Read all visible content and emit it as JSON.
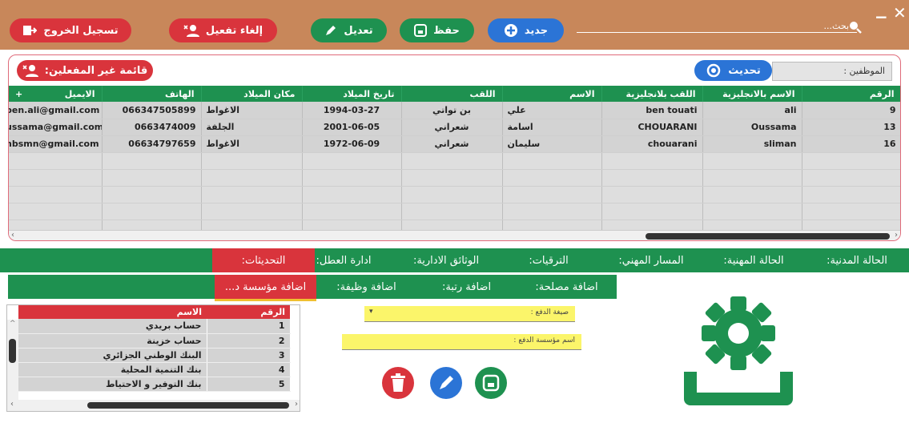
{
  "toolbar": {
    "logout": "تسجيل الخروج",
    "deactivate": "إلغاء تفعيل",
    "edit": "تعديل",
    "save": "حفظ",
    "new": "جديد",
    "search_placeholder": "بحث..."
  },
  "employees": {
    "label": "الموظفين :",
    "refresh": "تحديث",
    "inactive_list": "قائمة غير المفعلين:",
    "columns": [
      "الرقم",
      "الاسم بالانجليزية",
      "اللقب بلانجليزية",
      "الاسم",
      "اللقب",
      "تاريخ الميلاد",
      "مكان الميلاد",
      "الهاتف",
      "الايميل"
    ],
    "rows": [
      {
        "id": "9",
        "first_en": "ali",
        "last_en": "ben touati",
        "first": "علي",
        "last": "بن تواتي",
        "dob": "1994-03-27",
        "pob": "الاغواط",
        "phone": "066347505899",
        "email": "ben.ali@gmail.com"
      },
      {
        "id": "13",
        "first_en": "Oussama",
        "last_en": "CHOUARANI",
        "first": "اسامة",
        "last": "شعراني",
        "dob": "2001-06-05",
        "pob": "الجلفة",
        "phone": "0663474009",
        "email": "ussama@gmail.com"
      },
      {
        "id": "16",
        "first_en": "sliman",
        "last_en": "chouarani",
        "first": "سليمان",
        "last": "شعراني",
        "dob": "1972-06-09",
        "pob": "الاغواط",
        "phone": "06634797659",
        "email": "nbsmn@gmail.com"
      }
    ]
  },
  "tabs_main": [
    "الحالة المدنية:",
    "الحالة المهنية:",
    "المسار المهني:",
    "الترقيات:",
    "الوثائق الادارية:",
    "ادارة العطل:",
    "التحديثات:"
  ],
  "tabs_sub": [
    "اضافة مصلحة:",
    "اضافة رتبة:",
    "اضافة وظيفة:",
    "اضافة مؤسسة د..."
  ],
  "banks": {
    "col_num": "الرقم",
    "col_name": "الاسم",
    "rows": [
      {
        "n": "1",
        "name": "حساب بريدي"
      },
      {
        "n": "2",
        "name": "حساب خزينة"
      },
      {
        "n": "3",
        "name": "البنك الوطني الجزائري"
      },
      {
        "n": "4",
        "name": "بنك التنمية المحلية"
      },
      {
        "n": "5",
        "name": "بنك التوفير و الاحتياط"
      }
    ]
  },
  "form": {
    "payment_method": "صيغة الدفع :",
    "payment_institution": "اسم مؤسسة الدفع :"
  },
  "colors": {
    "green": "#1e9150",
    "red": "#d9343c",
    "blue": "#2b74d6",
    "bar": "#c8875a"
  }
}
